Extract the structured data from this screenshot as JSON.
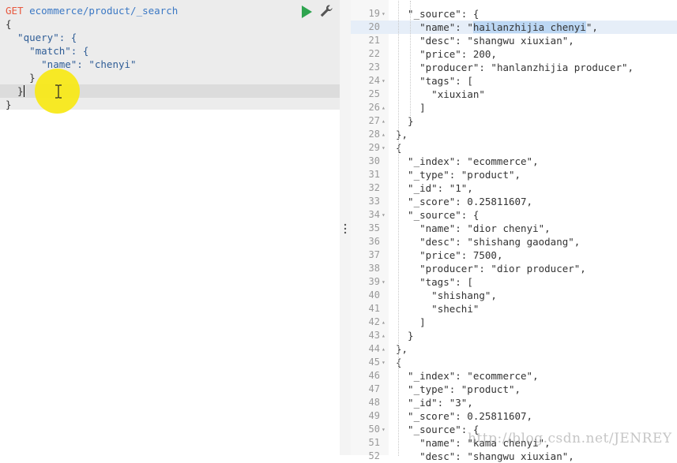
{
  "request": {
    "method": "GET",
    "path": "ecommerce/product/_search",
    "body_lines": [
      "{",
      "  \"query\": {",
      "    \"match\": {",
      "      \"name\": \"chenyi\"",
      "    }",
      "  }",
      "}"
    ]
  },
  "toolbar": {
    "run_icon": "play-icon",
    "settings_icon": "wrench-icon"
  },
  "response": {
    "first_line": 19,
    "highlight_line": 20,
    "selected_text": "hailanzhijia chenyi",
    "lines": [
      {
        "n": 19,
        "fold": "open",
        "text": "\"_source\": {",
        "indent": 5
      },
      {
        "n": 20,
        "fold": "",
        "text": "\"name\": \"hailanzhijia chenyi\",",
        "indent": 6
      },
      {
        "n": 21,
        "fold": "",
        "text": "\"desc\": \"shangwu xiuxian\",",
        "indent": 6
      },
      {
        "n": 22,
        "fold": "",
        "text": "\"price\": 200,",
        "indent": 6
      },
      {
        "n": 23,
        "fold": "",
        "text": "\"producer\": \"hanlanzhijia producer\",",
        "indent": 6
      },
      {
        "n": 24,
        "fold": "open",
        "text": "\"tags\": [",
        "indent": 6
      },
      {
        "n": 25,
        "fold": "",
        "text": "\"xiuxian\"",
        "indent": 7
      },
      {
        "n": 26,
        "fold": "close",
        "text": "]",
        "indent": 6
      },
      {
        "n": 27,
        "fold": "close",
        "text": "}",
        "indent": 5
      },
      {
        "n": 28,
        "fold": "close",
        "text": "},",
        "indent": 4
      },
      {
        "n": 29,
        "fold": "open",
        "text": "{",
        "indent": 4
      },
      {
        "n": 30,
        "fold": "",
        "text": "\"_index\": \"ecommerce\",",
        "indent": 5
      },
      {
        "n": 31,
        "fold": "",
        "text": "\"_type\": \"product\",",
        "indent": 5
      },
      {
        "n": 32,
        "fold": "",
        "text": "\"_id\": \"1\",",
        "indent": 5
      },
      {
        "n": 33,
        "fold": "",
        "text": "\"_score\": 0.25811607,",
        "indent": 5
      },
      {
        "n": 34,
        "fold": "open",
        "text": "\"_source\": {",
        "indent": 5
      },
      {
        "n": 35,
        "fold": "",
        "text": "\"name\": \"dior chenyi\",",
        "indent": 6
      },
      {
        "n": 36,
        "fold": "",
        "text": "\"desc\": \"shishang gaodang\",",
        "indent": 6
      },
      {
        "n": 37,
        "fold": "",
        "text": "\"price\": 7500,",
        "indent": 6
      },
      {
        "n": 38,
        "fold": "",
        "text": "\"producer\": \"dior producer\",",
        "indent": 6
      },
      {
        "n": 39,
        "fold": "open",
        "text": "\"tags\": [",
        "indent": 6
      },
      {
        "n": 40,
        "fold": "",
        "text": "\"shishang\",",
        "indent": 7
      },
      {
        "n": 41,
        "fold": "",
        "text": "\"shechi\"",
        "indent": 7
      },
      {
        "n": 42,
        "fold": "close",
        "text": "]",
        "indent": 6
      },
      {
        "n": 43,
        "fold": "close",
        "text": "}",
        "indent": 5
      },
      {
        "n": 44,
        "fold": "close",
        "text": "},",
        "indent": 4
      },
      {
        "n": 45,
        "fold": "open",
        "text": "{",
        "indent": 4
      },
      {
        "n": 46,
        "fold": "",
        "text": "\"_index\": \"ecommerce\",",
        "indent": 5
      },
      {
        "n": 47,
        "fold": "",
        "text": "\"_type\": \"product\",",
        "indent": 5
      },
      {
        "n": 48,
        "fold": "",
        "text": "\"_id\": \"3\",",
        "indent": 5
      },
      {
        "n": 49,
        "fold": "",
        "text": "\"_score\": 0.25811607,",
        "indent": 5
      },
      {
        "n": 50,
        "fold": "open",
        "text": "\"_source\": {",
        "indent": 5
      },
      {
        "n": 51,
        "fold": "",
        "text": "\"name\": \"kama chenyi\",",
        "indent": 6
      },
      {
        "n": 52,
        "fold": "",
        "text": "\"desc\": \"shangwu xiuxian\",",
        "indent": 6
      }
    ]
  },
  "watermark": "http://blog.csdn.net/JENREY",
  "colors": {
    "method": "#e8593f",
    "path": "#3b78c4",
    "run": "#2ea44f",
    "highlight": "#f7e814",
    "selection": "#bcd7f3"
  }
}
